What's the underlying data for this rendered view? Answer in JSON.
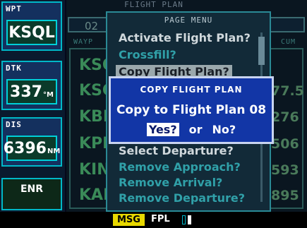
{
  "sidebar": {
    "fields": [
      {
        "label": "WPT",
        "value": "KSQL",
        "unit": ""
      },
      {
        "label": "DTK",
        "value": "337",
        "unit": "°M"
      },
      {
        "label": "DIS",
        "value": "6396",
        "unit": "NM"
      }
    ],
    "nav_mode": "ENR"
  },
  "flight_plan_page": {
    "title": "FLIGHT PLAN",
    "plan_number": "02",
    "col_waypoint": "WAYP",
    "col_distance": "CUM",
    "waypoints": [
      "KSQL",
      "KSC",
      "KBF",
      "KPF",
      "KIN",
      "KAE"
    ],
    "distances": [
      "",
      "77.5",
      "276",
      "506",
      "593",
      "895"
    ]
  },
  "page_menu": {
    "title": "PAGE MENU",
    "items": [
      {
        "label": "Activate Flight Plan?",
        "style": "active"
      },
      {
        "label": "Crossfill?",
        "style": "dim"
      },
      {
        "label": "Copy Flight Plan?",
        "style": "hilite"
      },
      {
        "label": "Select Departure?",
        "style": "active"
      },
      {
        "label": "Remove Approach?",
        "style": "dim"
      },
      {
        "label": "Remove Arrival?",
        "style": "dim"
      },
      {
        "label": "Remove Departure?",
        "style": "dim"
      }
    ]
  },
  "dialog": {
    "title": "COPY FLIGHT PLAN",
    "text": "Copy to Flight Plan 08",
    "yes_label": "Yes?",
    "or_label": "or",
    "no_label": "No?"
  },
  "status_bar": {
    "msg_label": "MSG",
    "fpl_label": "FPL"
  },
  "colors": {
    "accent": "#00b8c8",
    "dialog": "#1236a6",
    "msg": "#e8d800"
  }
}
